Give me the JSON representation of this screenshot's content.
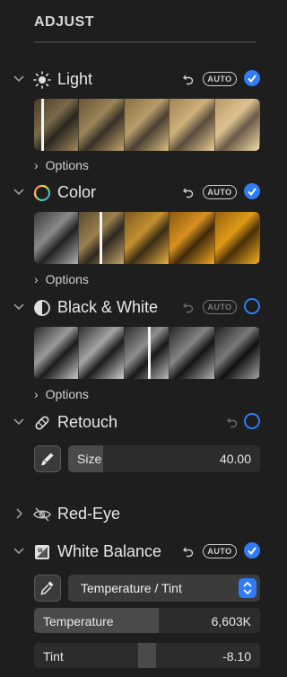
{
  "panel": {
    "title": "ADJUST"
  },
  "sections": {
    "light": {
      "label": "Light",
      "auto": "AUTO",
      "enabled": true,
      "options": "Options",
      "playhead_fraction": 0.03
    },
    "color": {
      "label": "Color",
      "auto": "AUTO",
      "enabled": true,
      "options": "Options",
      "playhead_fraction": 0.29
    },
    "bw": {
      "label": "Black & White",
      "auto": "AUTO",
      "enabled": false,
      "options": "Options",
      "playhead_fraction": 0.51
    },
    "retouch": {
      "label": "Retouch",
      "enabled": false,
      "size_label": "Size",
      "size_value": "40.00",
      "size_fraction": 0.18
    },
    "redeye": {
      "label": "Red-Eye"
    },
    "white_balance": {
      "label": "White Balance",
      "auto": "AUTO",
      "enabled": true,
      "mode": "Temperature / Tint",
      "temperature_label": "Temperature",
      "temperature_value": "6,603K",
      "temperature_fraction": 0.55,
      "tint_label": "Tint",
      "tint_value": "-8.10",
      "tint_fraction": 0.46
    }
  },
  "colors": {
    "accent": "#2f7cf6",
    "background": "#1e1e1e"
  },
  "icons": [
    "chevron-down-icon",
    "chevron-right-icon",
    "sun-icon",
    "color-wheel-icon",
    "half-circle-icon",
    "bandage-icon",
    "eye-slash-icon",
    "white-balance-icon",
    "brush-icon",
    "eyedropper-icon",
    "undo-icon",
    "checkmark-icon",
    "up-down-arrow-icon"
  ]
}
